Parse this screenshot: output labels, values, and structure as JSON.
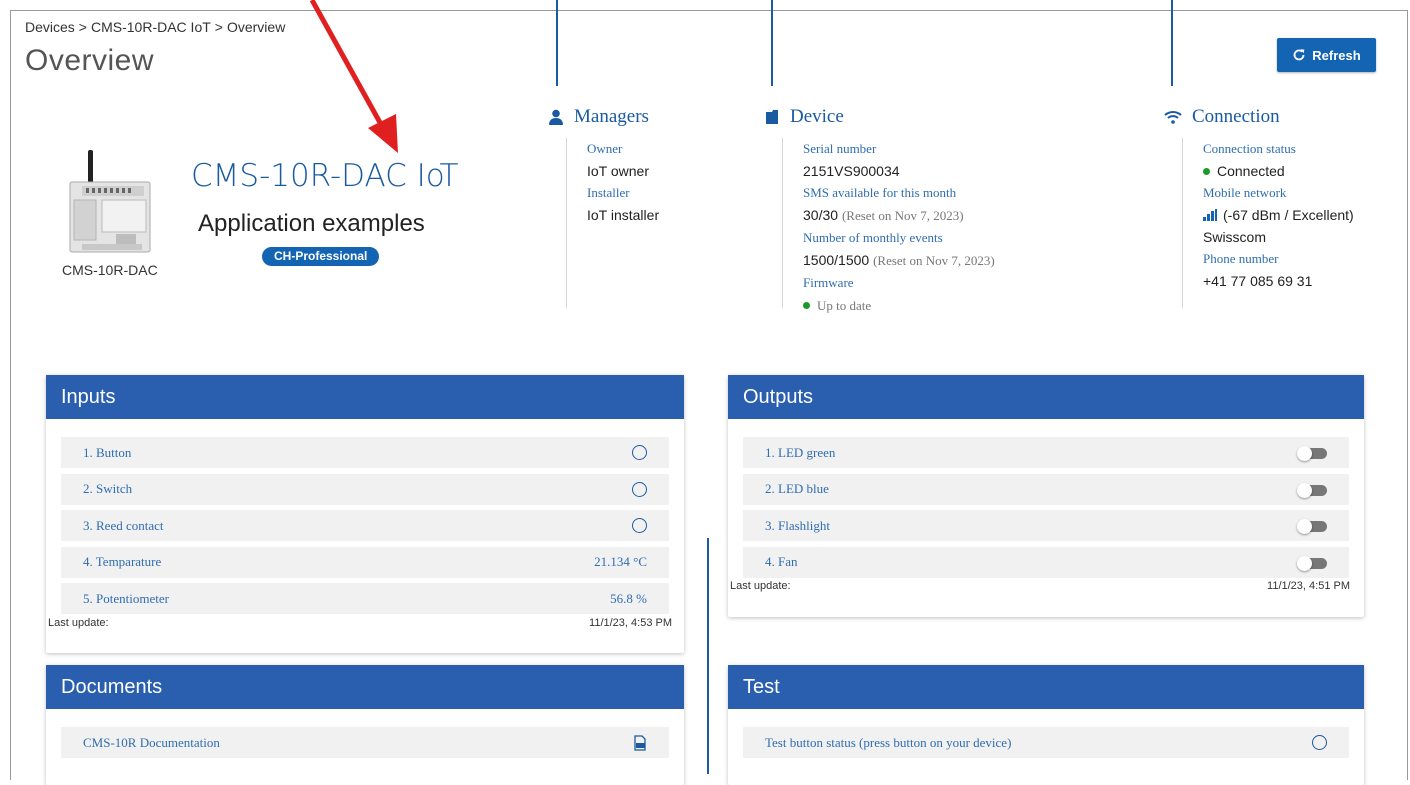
{
  "breadcrumb": [
    "Devices",
    "CMS-10R-DAC IoT",
    "Overview"
  ],
  "page_title": "Overview",
  "refresh_label": "Refresh",
  "device": {
    "caption": "CMS-10R-DAC",
    "name": "CMS-10R-DAC IoT",
    "subtitle": "Application examples",
    "badge": "CH-Professional"
  },
  "managers": {
    "title": "Managers",
    "owner_label": "Owner",
    "owner_value": "IoT owner",
    "installer_label": "Installer",
    "installer_value": "IoT installer"
  },
  "device_info": {
    "title": "Device",
    "serial_label": "Serial number",
    "serial_value": "2151VS900034",
    "sms_label": "SMS available for this month",
    "sms_value": "30/30",
    "sms_note": "(Reset on Nov 7, 2023)",
    "events_label": "Number of monthly events",
    "events_value": "1500/1500",
    "events_note": "(Reset on Nov 7, 2023)",
    "firmware_label": "Firmware",
    "firmware_value": "Up to date"
  },
  "connection": {
    "title": "Connection",
    "status_label": "Connection status",
    "status_value": "Connected",
    "network_label": "Mobile network",
    "network_signal": "(-67 dBm / Excellent)",
    "network_provider": "Swisscom",
    "phone_label": "Phone number",
    "phone_value": "+41 77 085 69 31"
  },
  "inputs": {
    "title": "Inputs",
    "rows": [
      {
        "label": "1. Button",
        "value": ""
      },
      {
        "label": "2. Switch",
        "value": ""
      },
      {
        "label": "3. Reed contact",
        "value": ""
      },
      {
        "label": "4. Temparature",
        "value": "21.134 °C"
      },
      {
        "label": "5. Potentiometer",
        "value": "56.8 %"
      }
    ],
    "last_update_label": "Last update:",
    "last_update_value": "11/1/23, 4:53 PM"
  },
  "outputs": {
    "title": "Outputs",
    "rows": [
      {
        "label": "1. LED green"
      },
      {
        "label": "2. LED blue"
      },
      {
        "label": "3. Flashlight"
      },
      {
        "label": "4. Fan"
      }
    ],
    "last_update_label": "Last update:",
    "last_update_value": "11/1/23, 4:51 PM"
  },
  "documents": {
    "title": "Documents",
    "rows": [
      {
        "label": "CMS-10R Documentation"
      }
    ]
  },
  "test": {
    "title": "Test",
    "rows": [
      {
        "label": "Test button status (press button on your device)"
      }
    ]
  },
  "colors": {
    "accent": "#1464b4",
    "panel_header": "#2a5fb0",
    "status_green": "#1a9a2a",
    "callout_arrow": "#e02020"
  }
}
